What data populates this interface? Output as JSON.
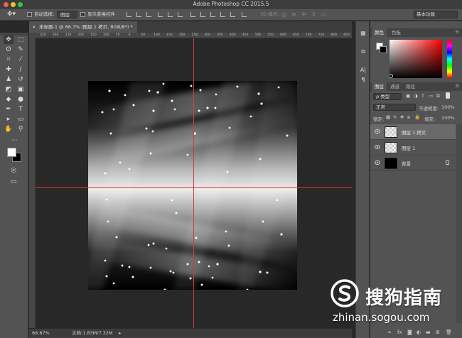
{
  "app": {
    "title": "Adobe Photoshop CC 2015.5"
  },
  "options_bar": {
    "tool_icon": "move-tool-icon",
    "auto_select_label": "自动选择:",
    "auto_select_value": "图层",
    "show_transform_label": "显示变换控件",
    "mode_3d_label": "3D 模式:",
    "workspace": "基本功能"
  },
  "document": {
    "tab_title": "未标题-1 @ 66.7% (图层 1 拷贝, RGB/8*) *",
    "ruler_labels": [
      "350",
      "300",
      "250",
      "200",
      "150",
      "100",
      "50",
      "0",
      "50",
      "100",
      "150",
      "200",
      "250",
      "300",
      "350",
      "400",
      "450",
      "500",
      "550",
      "600",
      "650",
      "700",
      "750",
      "800",
      "850"
    ],
    "guides": {
      "horizontal": true,
      "vertical": true,
      "color": "#d93a3a"
    }
  },
  "status_bar": {
    "zoom": "66.67%",
    "doc_info": "文档:1.83M/7.32M"
  },
  "tools": [
    {
      "name": "move-tool-icon",
      "glyph": "✥",
      "active": true
    },
    {
      "name": "marquee-tool-icon",
      "glyph": "⬚"
    },
    {
      "name": "lasso-tool-icon",
      "glyph": "ʘ"
    },
    {
      "name": "quick-select-tool-icon",
      "glyph": "✎"
    },
    {
      "name": "crop-tool-icon",
      "glyph": "⌗"
    },
    {
      "name": "eyedropper-tool-icon",
      "glyph": "⁄"
    },
    {
      "name": "healing-brush-icon",
      "glyph": "✚"
    },
    {
      "name": "brush-tool-icon",
      "glyph": "∕"
    },
    {
      "name": "clone-stamp-icon",
      "glyph": "♟"
    },
    {
      "name": "history-brush-icon",
      "glyph": "↺"
    },
    {
      "name": "eraser-tool-icon",
      "glyph": "◩"
    },
    {
      "name": "gradient-tool-icon",
      "glyph": "▣"
    },
    {
      "name": "blur-tool-icon",
      "glyph": "◆"
    },
    {
      "name": "dodge-tool-icon",
      "glyph": "●"
    },
    {
      "name": "pen-tool-icon",
      "glyph": "✒"
    },
    {
      "name": "type-tool-icon",
      "glyph": "T"
    },
    {
      "name": "path-select-icon",
      "glyph": "▸"
    },
    {
      "name": "shape-tool-icon",
      "glyph": "▭"
    },
    {
      "name": "hand-tool-icon",
      "glyph": "✋"
    },
    {
      "name": "zoom-tool-icon",
      "glyph": "⚲"
    },
    {
      "name": "more-tools-icon",
      "glyph": "···"
    }
  ],
  "color_panel": {
    "tabs": [
      "颜色",
      "色板"
    ],
    "foreground": "#ffffff",
    "background": "#000000",
    "hue_color": "#ff0000"
  },
  "layers_panel": {
    "tabs": [
      "图层",
      "通道",
      "路径"
    ],
    "filter_kind": "ρ 类型",
    "blend_mode": "正常",
    "opacity_label": "不透明度:",
    "opacity_value": "100%",
    "lock_label": "锁定:",
    "fill_label": "填充:",
    "fill_value": "100%",
    "layers": [
      {
        "name": "图层 1 拷贝",
        "thumb": "checker",
        "selected": true,
        "locked": false
      },
      {
        "name": "图层 1",
        "thumb": "checker",
        "selected": false,
        "locked": false
      },
      {
        "name": "背景",
        "thumb": "black",
        "selected": false,
        "locked": true
      }
    ],
    "bottom_icons": [
      "link-icon",
      "fx-icon",
      "mask-icon",
      "adjustment-icon",
      "group-icon",
      "new-layer-icon",
      "trash-icon"
    ]
  },
  "watermark": {
    "brand": "搜狗指南",
    "url": "zhinan.sogou.com"
  }
}
